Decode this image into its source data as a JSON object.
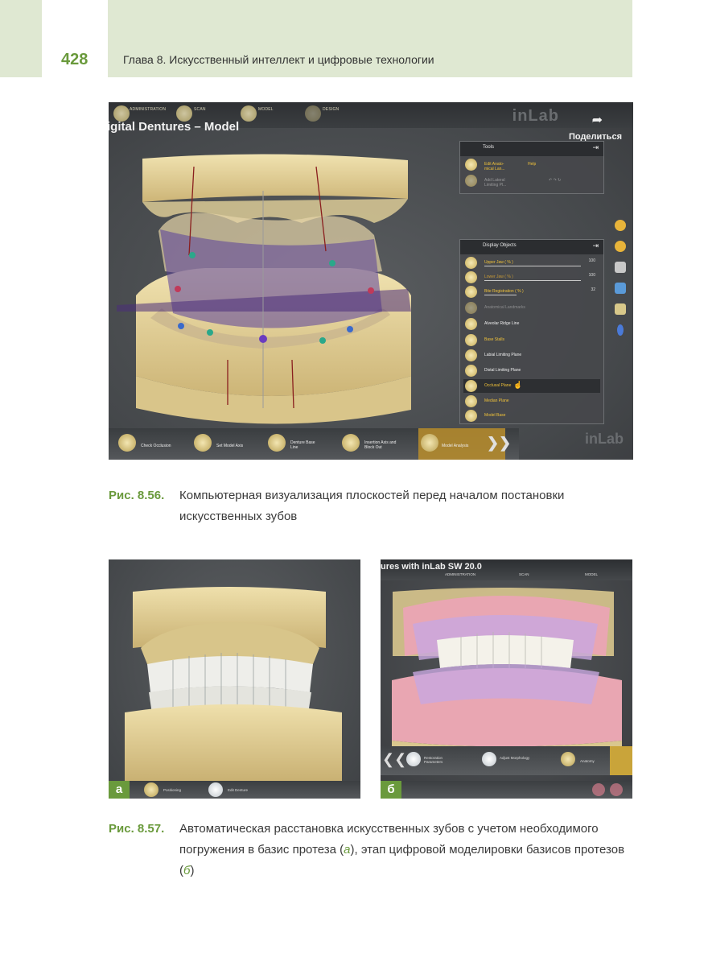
{
  "header": {
    "page_number": "428",
    "chapter": "Глава 8. Искусственный интеллект и цифровые технологии"
  },
  "figure1": {
    "topbar": {
      "items": [
        "ADMINISTRATION",
        "SCAN",
        "MODEL",
        "DESIGN"
      ]
    },
    "screen_title": "igital Dentures – Model",
    "brand": "inLab",
    "share_label": "Поделиться",
    "tools_panel": {
      "title": "Tools",
      "items": [
        "Edit Anato-mical Lan...",
        "Help",
        "Add Lateral Limiting Pl..."
      ]
    },
    "display_objects": {
      "title": "Display Objects",
      "items": [
        {
          "label": "Upper Jaw  ( % )",
          "value": "100"
        },
        {
          "label": "Lower Jaw  ( % )",
          "value": "100"
        },
        {
          "label": "Bite Registration  ( % )",
          "value": "32"
        },
        {
          "label": "Anatomical Landmarks",
          "value": ""
        },
        {
          "label": "Alveolar Ridge Line",
          "value": ""
        },
        {
          "label": "Base Stalls",
          "value": ""
        },
        {
          "label": "Labial Limiting Plane",
          "value": ""
        },
        {
          "label": "Distal Limiting Plane",
          "value": ""
        },
        {
          "label": "Occlusal Plane",
          "value": ""
        },
        {
          "label": "Median Plane",
          "value": ""
        },
        {
          "label": "Model Base",
          "value": ""
        }
      ]
    },
    "bottom_bar": {
      "items": [
        "Check Occlusion",
        "Set Model Axis",
        "Denture Base Line",
        "Insertion Axis and Block Out",
        "Model Analysis"
      ],
      "arrows": "❯❯"
    },
    "caption_label": "Рис. 8.56.",
    "caption_text": "Компьютерная визуализация плоскостей перед началом постановки искусственных зубов"
  },
  "figure2": {
    "panel_a": {
      "label": "а",
      "bar_items": [
        "Positioning",
        "Edit Denture"
      ]
    },
    "panel_b": {
      "label": "б",
      "title_text": "ures with inLab SW 20.0",
      "topbar_items": [
        "ADMINISTRATION",
        "SCAN",
        "MODEL"
      ],
      "bar_items": [
        "Restoration Parameters",
        "Adjust Morphology",
        "Anatomy"
      ]
    },
    "caption_label": "Рис. 8.57.",
    "caption_part1": "Автоматическая расстановка искусственных зубов с учетом необходимого погружения в базис протеза (",
    "caption_a": "а",
    "caption_part2": "), этап цифровой моделировки базисов протезов (",
    "caption_b": "б",
    "caption_part3": ")"
  },
  "colors": {
    "accent_green": "#6a9a3c",
    "header_bg": "#dfe8d2",
    "model_yellow": "#e9d9a3",
    "plane_purple": "#5a3f9a"
  }
}
